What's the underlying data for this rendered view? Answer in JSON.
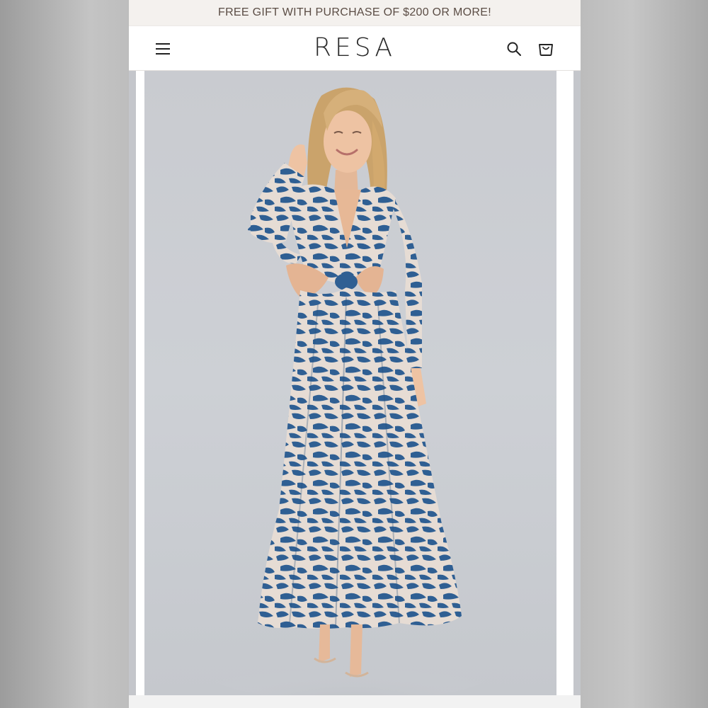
{
  "announcement": {
    "text": "FREE GIFT WITH PURCHASE OF $200 OR MORE!"
  },
  "header": {
    "logo": "RESA",
    "menu_icon": "hamburger-menu-icon",
    "search_icon": "search-icon",
    "cart_icon": "shopping-bag-icon"
  },
  "product_image": {
    "subject": "model in blue and cream animal print maxi dress with cutout waist"
  },
  "colors": {
    "announcement_bg": "#f4f1ee",
    "announcement_text": "#5b4d45",
    "dress_blue": "#2f5f93",
    "dress_cream": "#e6dcd4",
    "backdrop": "#cbcdd2"
  }
}
